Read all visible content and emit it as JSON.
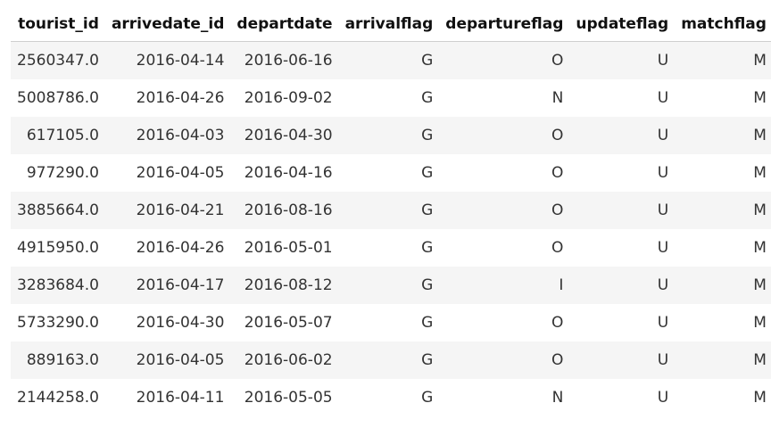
{
  "table": {
    "columns": [
      "tourist_id",
      "arrivedate_id",
      "departdate",
      "arrivalflag",
      "departureflag",
      "updateflag",
      "matchflag"
    ],
    "rows": [
      [
        "2560347.0",
        "2016-04-14",
        "2016-06-16",
        "G",
        "O",
        "U",
        "M"
      ],
      [
        "5008786.0",
        "2016-04-26",
        "2016-09-02",
        "G",
        "N",
        "U",
        "M"
      ],
      [
        "617105.0",
        "2016-04-03",
        "2016-04-30",
        "G",
        "O",
        "U",
        "M"
      ],
      [
        "977290.0",
        "2016-04-05",
        "2016-04-16",
        "G",
        "O",
        "U",
        "M"
      ],
      [
        "3885664.0",
        "2016-04-21",
        "2016-08-16",
        "G",
        "O",
        "U",
        "M"
      ],
      [
        "4915950.0",
        "2016-04-26",
        "2016-05-01",
        "G",
        "O",
        "U",
        "M"
      ],
      [
        "3283684.0",
        "2016-04-17",
        "2016-08-12",
        "G",
        "I",
        "U",
        "M"
      ],
      [
        "5733290.0",
        "2016-04-30",
        "2016-05-07",
        "G",
        "O",
        "U",
        "M"
      ],
      [
        "889163.0",
        "2016-04-05",
        "2016-06-02",
        "G",
        "O",
        "U",
        "M"
      ],
      [
        "2144258.0",
        "2016-04-11",
        "2016-05-05",
        "G",
        "N",
        "U",
        "M"
      ]
    ]
  }
}
